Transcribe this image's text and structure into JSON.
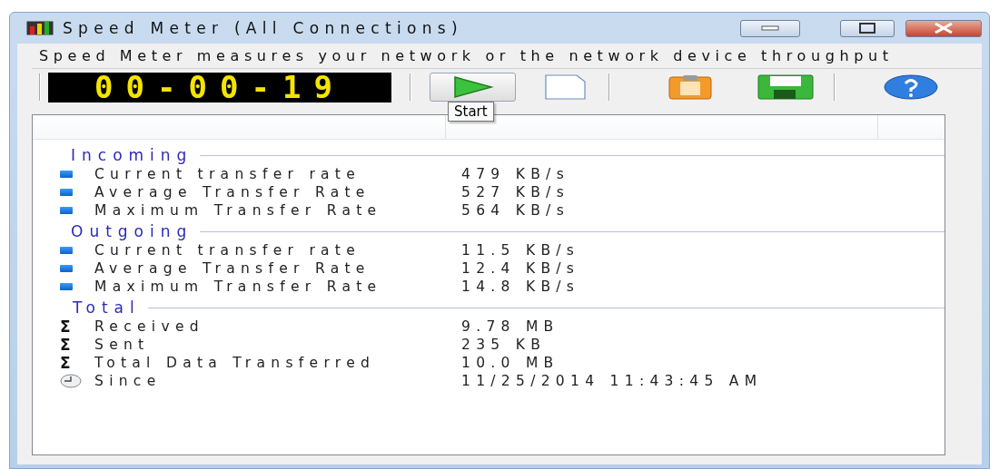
{
  "window": {
    "title": "Speed Meter (All Connections)"
  },
  "description": "Speed Meter measures your network or the network device throughput",
  "timer": "00-00-19",
  "toolbar": [
    {
      "kind": "play",
      "hovered": true
    },
    {
      "kind": "new",
      "hovered": false
    },
    {
      "kind": "sep"
    },
    {
      "kind": "clipboard",
      "hovered": false
    },
    {
      "kind": "save",
      "hovered": false
    },
    {
      "kind": "sep"
    },
    {
      "kind": "help",
      "hovered": false
    }
  ],
  "tooltip": "Start",
  "sections": [
    {
      "title": "Incoming",
      "rows": [
        {
          "kind": "rate",
          "label": "Current transfer rate",
          "value": "479 KB/s"
        },
        {
          "kind": "rate",
          "label": "Average Transfer Rate",
          "value": "527 KB/s"
        },
        {
          "kind": "rate",
          "label": "Maximum Transfer Rate",
          "value": "564 KB/s"
        }
      ]
    },
    {
      "title": "Outgoing",
      "rows": [
        {
          "kind": "rate",
          "label": "Current transfer rate",
          "value": "11.5 KB/s"
        },
        {
          "kind": "rate",
          "label": "Average Transfer Rate",
          "value": "12.4 KB/s"
        },
        {
          "kind": "rate",
          "label": "Maximum Transfer Rate",
          "value": "14.8 KB/s"
        }
      ]
    },
    {
      "title": "Total",
      "rows": [
        {
          "kind": "sum",
          "symbol": "Σ",
          "label": "Received",
          "value": "9.78 MB"
        },
        {
          "kind": "sum",
          "symbol": "Σ",
          "label": "Sent",
          "value": "235 KB"
        },
        {
          "kind": "sum",
          "symbol": "Σ",
          "label": "Total Data Transferred",
          "value": "10.0 MB"
        },
        {
          "kind": "time",
          "label": "Since",
          "value": "11/25/2014 11:43:45 AM"
        }
      ]
    }
  ]
}
